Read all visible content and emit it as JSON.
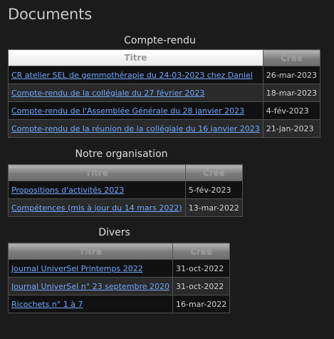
{
  "page": {
    "title": "Documents"
  },
  "sections": [
    {
      "title": "Compte-rendu",
      "col_title": "Titre",
      "col_created": "Créé",
      "rows": [
        {
          "title": "CR atelier SEL de gemmothérapie du 24-03-2023 chez Daniel",
          "created": "26-mar-2023"
        },
        {
          "title": "Compte-rendu de la collégiale du 27 février 2023",
          "created": "18-mar-2023"
        },
        {
          "title": "Compte-rendu de l'Assemblée Générale du 28 janvier 2023",
          "created": "4-fév-2023"
        },
        {
          "title": "Compte-rendu de la réunion de la collégiale du 16 janvier 2023",
          "created": "21-jan-2023"
        }
      ]
    },
    {
      "title": "Notre organisation",
      "col_title": "Titre",
      "col_created": "Créé",
      "rows": [
        {
          "title": "Propositions d'activités 2023",
          "created": "5-fév-2023"
        },
        {
          "title": "Compétences (mis à jour du 14 mars 2022)",
          "created": "13-mar-2022"
        }
      ]
    },
    {
      "title": "Divers",
      "col_title": "Titre",
      "col_created": "Créé",
      "rows": [
        {
          "title": "Journal UniverSel Printemps 2022",
          "created": "31-oct-2022"
        },
        {
          "title": "Journal UniverSel n° 23 septembre 2020",
          "created": "31-oct-2022"
        },
        {
          "title": "Ricochets n° 1 à 7",
          "created": "16-mar-2022"
        }
      ]
    }
  ],
  "colors": {
    "background": "#1b1b1b",
    "link": "#6fa8ff",
    "text": "#dcdcdc"
  }
}
